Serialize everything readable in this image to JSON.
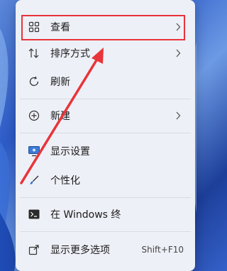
{
  "menu": {
    "items": [
      {
        "label": "查看",
        "icon": "grid-icon",
        "has_submenu": true
      },
      {
        "label": "排序方式",
        "icon": "sort-icon",
        "has_submenu": true
      },
      {
        "label": "刷新",
        "icon": "refresh-icon",
        "has_submenu": false
      },
      {
        "label": "新建",
        "icon": "add-circle-icon",
        "has_submenu": true
      },
      {
        "label": "显示设置",
        "icon": "display-icon",
        "has_submenu": false
      },
      {
        "label": "个性化",
        "icon": "brush-icon",
        "has_submenu": false
      },
      {
        "label": "在 Windows 终",
        "icon": "terminal-icon",
        "has_submenu": false
      },
      {
        "label": "显示更多选项",
        "icon": "more-options-icon",
        "shortcut": "Shift+F10"
      }
    ]
  },
  "annotation": {
    "highlight_color": "#e8343a"
  }
}
